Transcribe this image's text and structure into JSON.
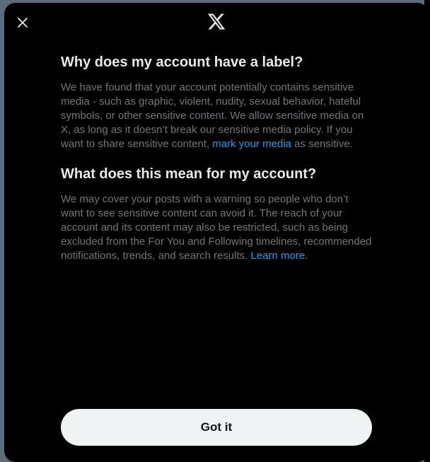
{
  "header": {
    "close_icon": "close-icon",
    "logo_icon": "x-logo-icon"
  },
  "section1": {
    "heading": "Why does my account have a label?",
    "body_before_link": "We have found that your account potentially contains sensitive media - such as graphic, violent, nudity, sexual behavior, hateful symbols, or other sensitive content. We allow sensitive media on X, as long as it doesn’t break our sensitive media policy. If you want to share sensitive content, ",
    "link": "mark your media",
    "body_after_link": " as sensitive."
  },
  "section2": {
    "heading": "What does this mean for my account?",
    "body_before_link": "We may cover your posts with a warning so people who don’t want to see sensitive content can avoid it. The reach of your account and its content may also be restricted, such as being excluded from the For You and Following timelines, recommended notifications, trends, and search results. ",
    "link": "Learn more",
    "body_after_link": "."
  },
  "footer": {
    "button_label": "Got it"
  },
  "colors": {
    "modal_bg": "#000000",
    "heading": "#e7e9ea",
    "body": "#71767b",
    "link": "#1d9bf0",
    "button_bg": "#eff3f4",
    "button_text": "#0f1419"
  }
}
